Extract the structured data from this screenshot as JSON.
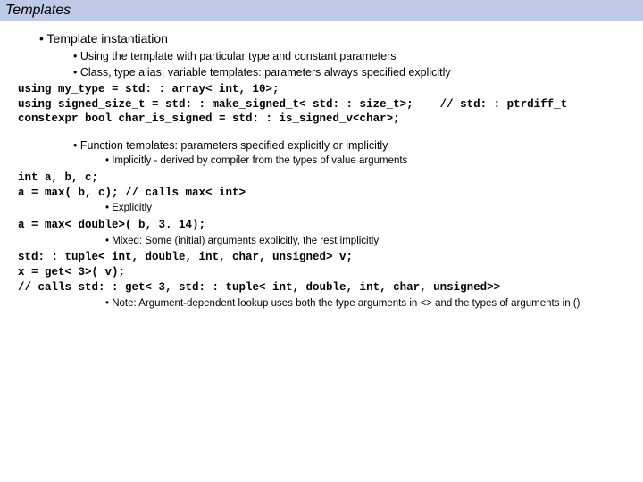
{
  "title": "Templates",
  "h1": "Template instantiation",
  "p1": "Using the template with particular type and constant parameters",
  "p2": "Class, type alias, variable templates: parameters always specified explicitly",
  "code1": "using my_type = std: : array< int, 10>;\nusing signed_size_t = std: : make_signed_t< std: : size_t>;    // std: : ptrdiff_t\nconstexpr bool char_is_signed = std: : is_signed_v<char>;",
  "p3": "Function templates: parameters specified explicitly or implicitly",
  "p4": "Implicitly - derived by compiler from the types of value arguments",
  "code2": "int a, b, c;\na = max( b, c); // calls max< int>",
  "p5": "Explicitly",
  "code3": "a = max< double>( b, 3. 14);",
  "p6": "Mixed: Some (initial) arguments explicitly, the rest implicitly",
  "code4": "std: : tuple< int, double, int, char, unsigned> v;\nx = get< 3>( v);\n// calls std: : get< 3, std: : tuple< int, double, int, char, unsigned>>",
  "p7": "Note: Argument-dependent lookup uses both the type arguments in <> and the types of arguments in ()"
}
